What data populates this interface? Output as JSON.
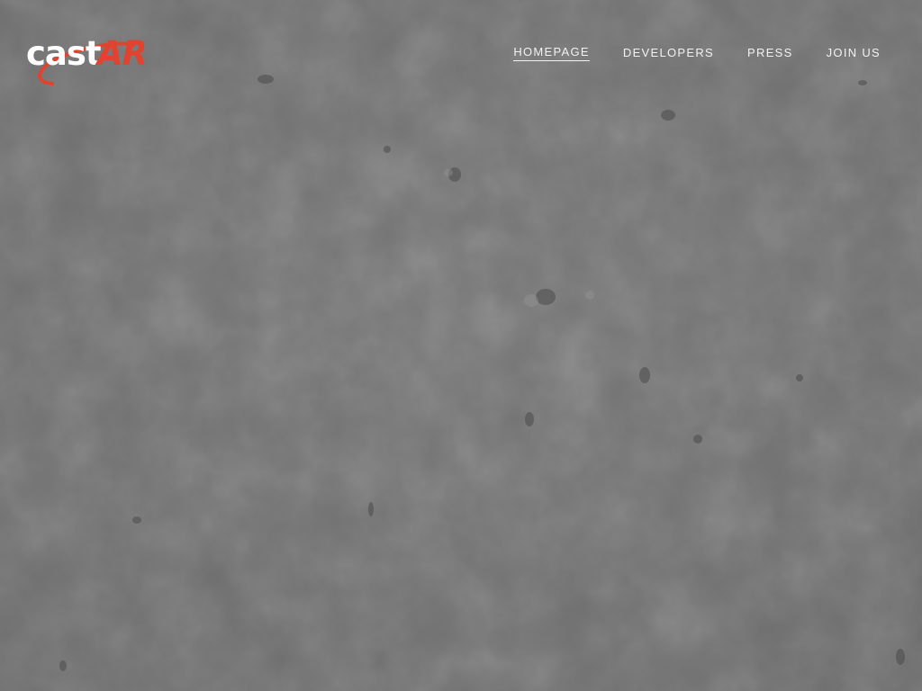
{
  "brand": {
    "logo_text": "castAR",
    "logo_colors": {
      "text": "#ffffff",
      "accent": "#e0432f"
    }
  },
  "nav": {
    "items": [
      {
        "label": "HOMEPAGE",
        "active": true
      },
      {
        "label": "DEVELOPERS",
        "active": false
      },
      {
        "label": "PRESS",
        "active": false
      },
      {
        "label": "JOIN US",
        "active": false
      }
    ]
  },
  "theme": {
    "background": "#777777",
    "nav_text": "#f2f2f2"
  }
}
